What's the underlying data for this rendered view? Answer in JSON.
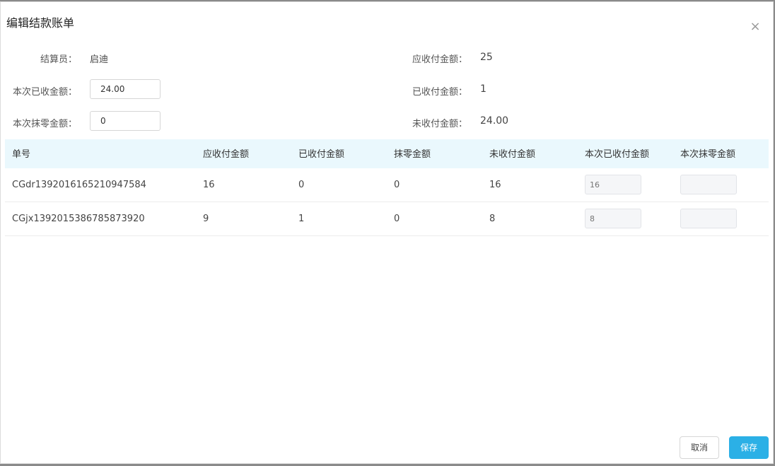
{
  "dialog": {
    "title": "编辑结款账单",
    "close_glyph": "×"
  },
  "form": {
    "settler_label": "结算员：",
    "settler_value": "启迪",
    "received_label": "本次已收金额：",
    "received_value": "24.00",
    "rounding_label": "本次抹零金额：",
    "rounding_value": "0",
    "receivable_label": "应收付金额：",
    "receivable_value": "25",
    "paid_label": "已收付金额：",
    "paid_value": "1",
    "unpaid_label": "未收付金额：",
    "unpaid_value": "24.00"
  },
  "table": {
    "columns": [
      "单号",
      "应收付金额",
      "已收付金额",
      "抹零金额",
      "未收付金额",
      "本次已收付金额",
      "本次抹零金额"
    ],
    "rows": [
      {
        "order_no": "CGdr1392016165210947584",
        "receivable": "16",
        "paid": "0",
        "rounding": "0",
        "unpaid": "16",
        "this_paid_placeholder": "16",
        "this_rounding": ""
      },
      {
        "order_no": "CGjx1392015386785873920",
        "receivable": "9",
        "paid": "1",
        "rounding": "0",
        "unpaid": "8",
        "this_paid_placeholder": "8",
        "this_rounding": ""
      }
    ]
  },
  "footer": {
    "cancel_label": "取消",
    "save_label": "保存"
  },
  "colors": {
    "accent": "#2bb0e6",
    "table_header_bg": "#eaf8fd"
  }
}
